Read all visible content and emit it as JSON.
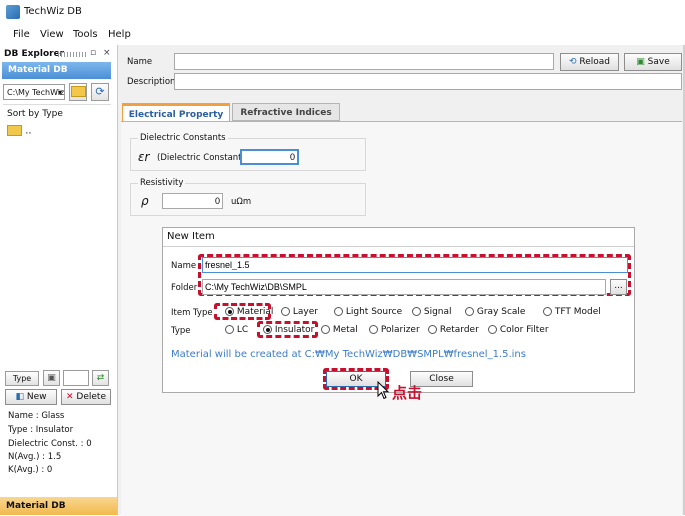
{
  "app": {
    "title": "TechWiz DB"
  },
  "menu": {
    "items": [
      "File",
      "View",
      "Tools",
      "Help"
    ]
  },
  "explorer": {
    "title": "DB Explorer",
    "pin": "▫",
    "close": "×",
    "header": "Material DB",
    "path_combo": "C:\\My TechWiz",
    "sort_label": "Sort by Type",
    "tree_item": "..",
    "type_button": "Type",
    "new_button": "New",
    "delete_button": "Delete",
    "info": [
      "Name : Glass",
      "Type : Insulator",
      "Dielectric Const. : 0",
      "N(Avg.) : 1.5",
      "K(Avg.) : 0"
    ],
    "footer": "Material DB"
  },
  "form": {
    "name_label": "Name",
    "description_label": "Description",
    "name_value": "",
    "description_value": "",
    "reload_button": "Reload",
    "save_button": "Save"
  },
  "tabs": [
    {
      "label": "Electrical Property",
      "active": true
    },
    {
      "label": "Refractive Indices",
      "active": false
    }
  ],
  "electrical": {
    "dielectric_title": "Dielectric Constants",
    "epsilon_symbol": "εr",
    "dielectric_label": "(Dielectric Constant)",
    "dielectric_value": "0",
    "resistivity_title": "Resistivity",
    "rho_symbol": "ρ",
    "resistivity_value": "0",
    "resistivity_unit": "uΩm"
  },
  "dialog": {
    "title": "New Item",
    "name_label": "Name",
    "name_value": "fresnel_1.5",
    "folder_label": "Folder",
    "folder_value": "C:\\My TechWiz\\DB\\SMPL",
    "browse_button": "...",
    "item_type_label": "Item Type",
    "item_types": [
      {
        "label": "Material",
        "checked": true
      },
      {
        "label": "Layer",
        "checked": false
      },
      {
        "label": "Light Source",
        "checked": false
      },
      {
        "label": "Signal",
        "checked": false
      },
      {
        "label": "Gray Scale",
        "checked": false
      },
      {
        "label": "TFT Model",
        "checked": false
      }
    ],
    "type_label": "Type",
    "types": [
      {
        "label": "LC",
        "checked": false
      },
      {
        "label": "Insulator",
        "checked": true
      },
      {
        "label": "Metal",
        "checked": false
      },
      {
        "label": "Polarizer",
        "checked": false
      },
      {
        "label": "Retarder",
        "checked": false
      },
      {
        "label": "Color Filter",
        "checked": false
      }
    ],
    "info_message": "Material will be created at C:₩My TechWiz₩DB₩SMPL₩fresnel_1.5.ins",
    "ok_button": "OK",
    "close_button": "Close"
  },
  "annotation": {
    "click_text": "点击"
  },
  "colors": {
    "accent_red": "#c8102e",
    "info_blue": "#3d7cc9",
    "header_blue": "#4a8fd6",
    "footer_orange": "#f1b94e"
  }
}
